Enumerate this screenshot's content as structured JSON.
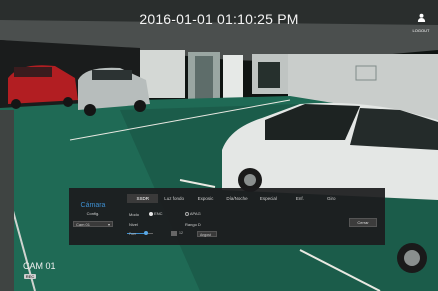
{
  "overlay": {
    "timestamp": "2016-01-01 01:10:25 PM",
    "logout_label": "LOGOUT",
    "camera_label": "CAM 01",
    "rec_label": "REC"
  },
  "panel": {
    "title": "Cámara",
    "subtitle": "Config.",
    "camera_select": "Cam 01",
    "tabs": [
      {
        "label": "SSDR",
        "active": true
      },
      {
        "label": "Luz fondo"
      },
      {
        "label": "Exposic"
      },
      {
        "label": "Día/Noche"
      },
      {
        "label": "Especial"
      },
      {
        "label": "Enf."
      },
      {
        "label": "Giro"
      }
    ],
    "mode_label": "Modo",
    "mode_on": "ENC",
    "mode_off": "APAG",
    "level_label": "Nivel",
    "range_label": "Rango D",
    "level_slider_label": "Fuer",
    "level_value_label": "12",
    "range_select": "Angost",
    "close_button": "Cerrar"
  },
  "colors": {
    "accent": "#3e8fd0",
    "panel_bg": "#1c1c1e",
    "floor": "#1f6a55"
  }
}
